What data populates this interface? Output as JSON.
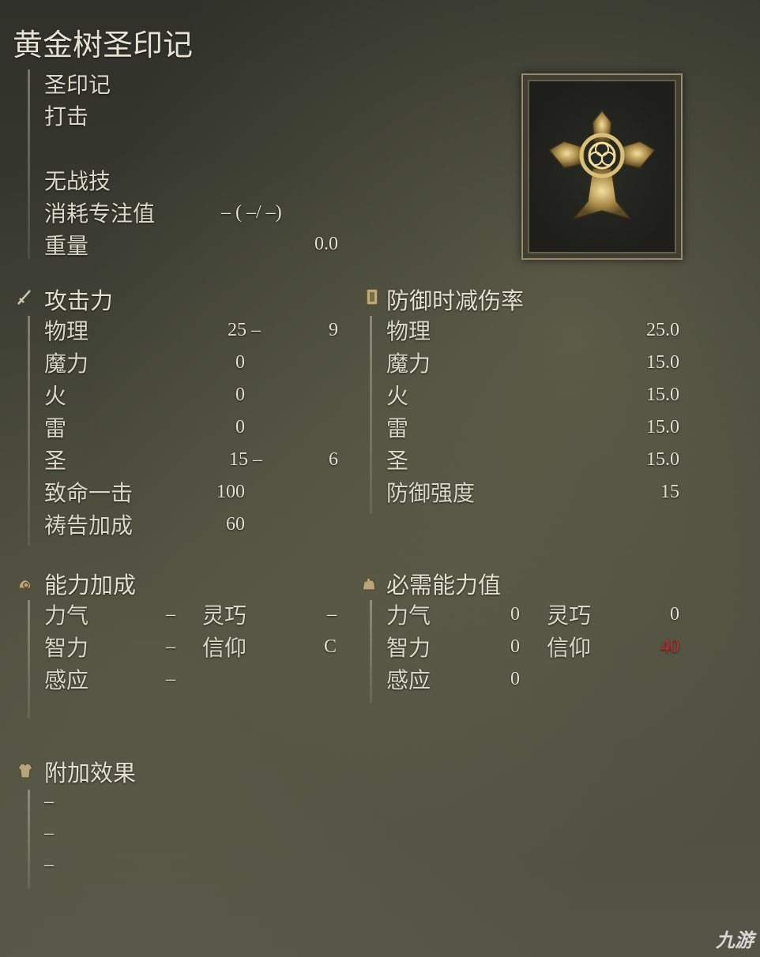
{
  "item": {
    "name": "黄金树圣印记",
    "type": "圣印记",
    "attack_type": "打击",
    "skill": "无战技",
    "fp_label": "消耗专注值",
    "fp_value": "– (    –/    –)",
    "weight_label": "重量",
    "weight_value": "0.0"
  },
  "attack": {
    "header": "攻击力",
    "rows": [
      {
        "label": "物理",
        "value": "25 –",
        "bonus": "9"
      },
      {
        "label": "魔力",
        "value": "0",
        "bonus": ""
      },
      {
        "label": "火",
        "value": "0",
        "bonus": ""
      },
      {
        "label": "雷",
        "value": "0",
        "bonus": ""
      },
      {
        "label": "圣",
        "value": "15 –",
        "bonus": "6"
      },
      {
        "label": "致命一击",
        "value": "100",
        "bonus": ""
      },
      {
        "label": "祷告加成",
        "value": "60",
        "bonus": ""
      }
    ]
  },
  "defense": {
    "header": "防御时减伤率",
    "rows": [
      {
        "label": "物理",
        "value": "25.0"
      },
      {
        "label": "魔力",
        "value": "15.0"
      },
      {
        "label": "火",
        "value": "15.0"
      },
      {
        "label": "雷",
        "value": "15.0"
      },
      {
        "label": "圣",
        "value": "15.0"
      },
      {
        "label": "防御强度",
        "value": "15"
      }
    ]
  },
  "scaling": {
    "header": "能力加成",
    "rows": [
      {
        "l1": "力气",
        "v1": "–",
        "l2": "灵巧",
        "v2": "–"
      },
      {
        "l1": "智力",
        "v1": "–",
        "l2": "信仰",
        "v2": "C"
      },
      {
        "l1": "感应",
        "v1": "–",
        "l2": "",
        "v2": ""
      }
    ]
  },
  "requirements": {
    "header": "必需能力值",
    "rows": [
      {
        "l1": "力气",
        "v1": "0",
        "l2": "灵巧",
        "v2": "0"
      },
      {
        "l1": "智力",
        "v1": "0",
        "l2": "信仰",
        "v2": "40"
      },
      {
        "l1": "感应",
        "v1": "0",
        "l2": "",
        "v2": ""
      }
    ],
    "unmet_color": "#c52a2a"
  },
  "passive": {
    "header": "附加效果",
    "rows": [
      "–",
      "–",
      "–"
    ]
  },
  "watermark": "九游"
}
